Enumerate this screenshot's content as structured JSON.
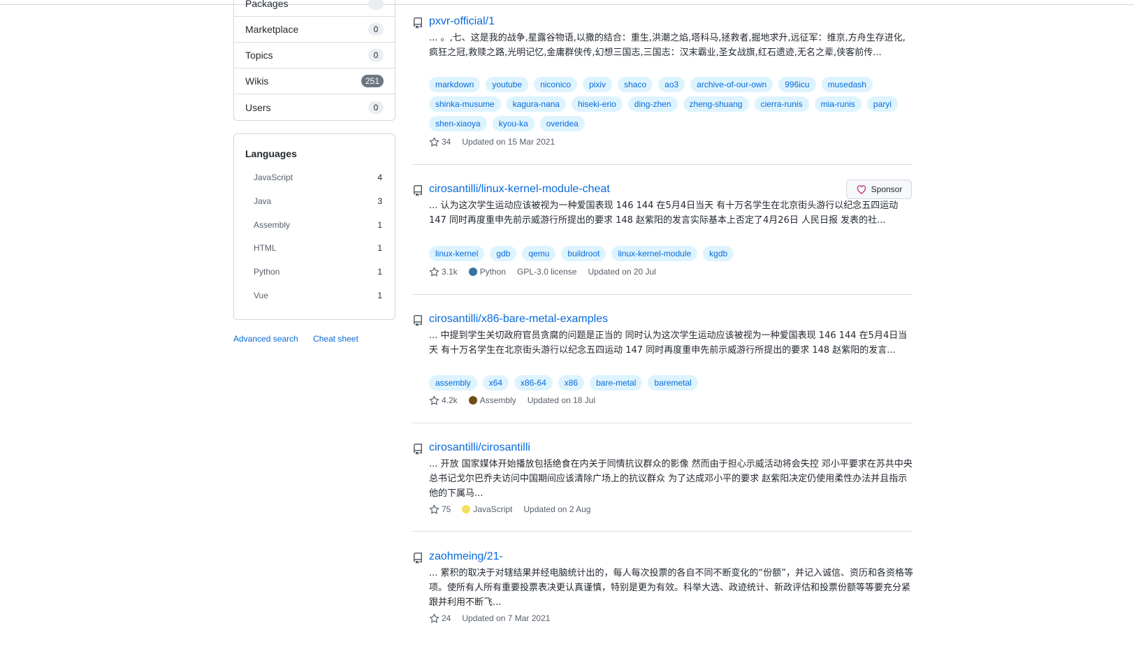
{
  "filters": [
    {
      "label": "Packages",
      "count": ""
    },
    {
      "label": "Marketplace",
      "count": "0"
    },
    {
      "label": "Topics",
      "count": "0"
    },
    {
      "label": "Wikis",
      "count": "251"
    },
    {
      "label": "Users",
      "count": "0"
    }
  ],
  "languages": {
    "title": "Languages",
    "items": [
      {
        "name": "JavaScript",
        "count": "4"
      },
      {
        "name": "Java",
        "count": "3"
      },
      {
        "name": "Assembly",
        "count": "1"
      },
      {
        "name": "HTML",
        "count": "1"
      },
      {
        "name": "Python",
        "count": "1"
      },
      {
        "name": "Vue",
        "count": "1"
      }
    ]
  },
  "links": {
    "advanced": "Advanced search",
    "cheat": "Cheat sheet"
  },
  "sponsor": {
    "label": "Sponsor"
  },
  "colors": {
    "link": "#0969da",
    "python": "#3572A5",
    "assembly": "#6E4C13",
    "javascript": "#f1e05a"
  },
  "results": [
    {
      "title": "pxvr-official/1",
      "description": "... 。,七、这是我的战争,星露谷物语,以撒的结合：重生,洪潮之焰,塔科马,拯救者,掘地求升,远征军：维京,方舟生存进化,疯狂之冠,救赎之路,光明记忆,金庸群侠传,幻想三国志,三国志：汉末霸业,圣女战旗,红石遗迹,无名之辈,侠客前传...",
      "topics": [
        "markdown",
        "youtube",
        "niconico",
        "pixiv",
        "shaco",
        "ao3",
        "archive-of-our-own",
        "996icu",
        "musedash",
        "shinka-musume",
        "kagura-nana",
        "hiseki-erio",
        "ding-zhen",
        "zheng-shuang",
        "cierra-runis",
        "mia-runis",
        "paryi",
        "shen-xiaoya",
        "kyou-ka",
        "overidea"
      ],
      "stars": "34",
      "language": "",
      "license": "",
      "updated": "Updated on 15 Mar 2021"
    },
    {
      "title": "cirosantilli/linux-kernel-module-cheat",
      "description": "... 认为这次学生运动应该被视为一种爱国表现 146 144 在5月4日当天 有十万名学生在北京街头游行以纪念五四运动 147 同时再度重申先前示威游行所提出的要求 148 赵紫阳的发言实际基本上否定了4月26日 人民日报 发表的社...",
      "topics": [
        "linux-kernel",
        "gdb",
        "qemu",
        "buildroot",
        "linux-kernel-module",
        "kgdb"
      ],
      "stars": "3.1k",
      "language": "Python",
      "license": "GPL-3.0 license",
      "updated": "Updated on 20 Jul"
    },
    {
      "title": "cirosantilli/x86-bare-metal-examples",
      "description": "... 中提到学生关切政府官员贪腐的问题是正当的 同时认为这次学生运动应该被视为一种爱国表现 146 144 在5月4日当天 有十万名学生在北京街头游行以纪念五四运动 147 同时再度重申先前示威游行所提出的要求 148 赵紫阳的发言...",
      "topics": [
        "assembly",
        "x64",
        "x86-64",
        "x86",
        "bare-metal",
        "baremetal"
      ],
      "stars": "4.2k",
      "language": "Assembly",
      "license": "",
      "updated": "Updated on 18 Jul"
    },
    {
      "title": "cirosantilli/cirosantilli",
      "description": "... 开放 国家媒体开始播放包括绝食在内关于同情抗议群众的影像 然而由于担心示威活动将会失控 邓小平要求在苏共中央总书记戈尔巴乔夫访问中国期间应该清除广场上的抗议群众 为了达成邓小平的要求 赵紫阳决定仍使用柔性办法并且指示他的下属马...",
      "topics": [],
      "stars": "75",
      "language": "JavaScript",
      "license": "",
      "updated": "Updated on 2 Aug"
    },
    {
      "title": "zaohmeing/21-",
      "description": "... 累积的取决于对辖结果并经电脑统计出的，每人每次投票的各自不同不断变化的“份额”，并记入诚信、资历和各资格等项。使所有人所有重要投票表决更认真谨慎，特别是更为有效。科举大选、政迹统计、新政评估和投票份额等等要充分紧跟并利用不断飞...",
      "topics": [],
      "stars": "24",
      "language": "",
      "license": "",
      "updated": "Updated on 7 Mar 2021"
    }
  ]
}
